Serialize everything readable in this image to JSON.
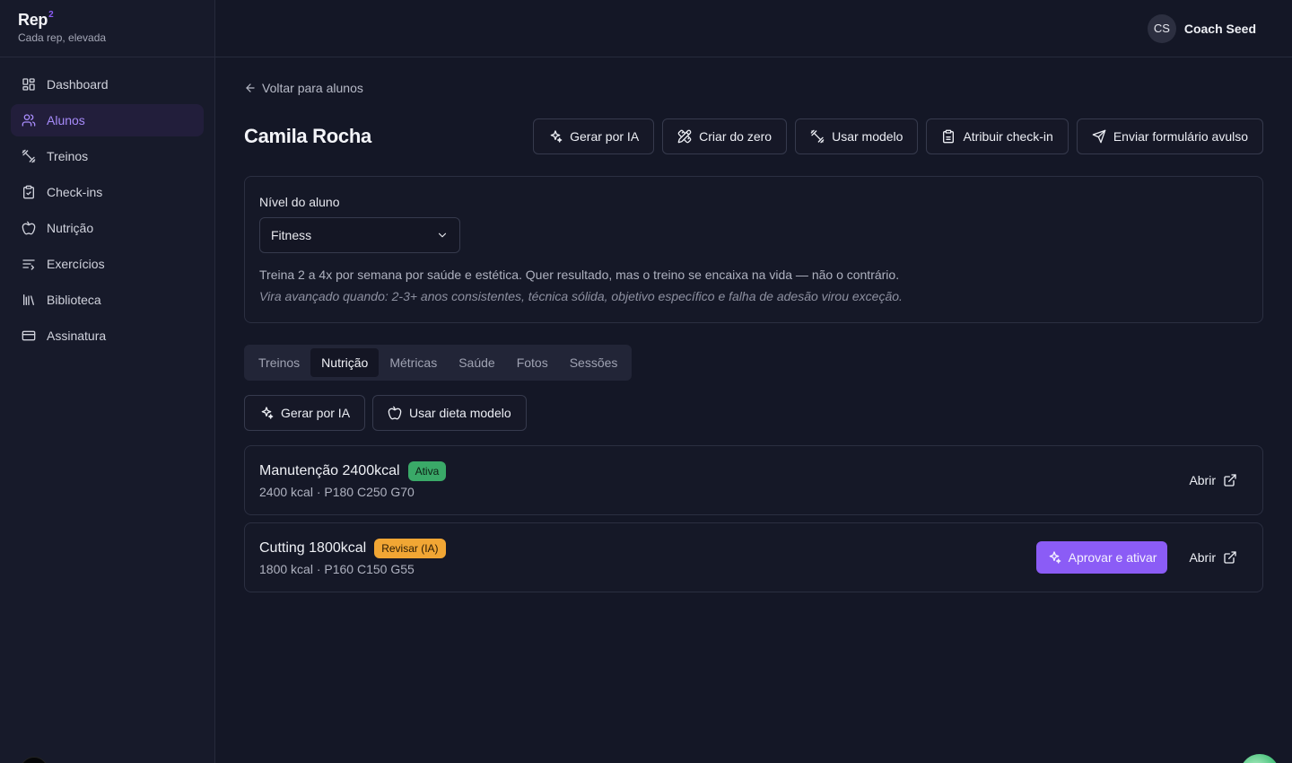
{
  "brand": {
    "name": "Rep",
    "superscript": "2",
    "tagline": "Cada rep, elevada"
  },
  "sidebar": {
    "items": [
      {
        "label": "Dashboard",
        "icon": "dashboard-icon",
        "active": false
      },
      {
        "label": "Alunos",
        "icon": "users-icon",
        "active": true
      },
      {
        "label": "Treinos",
        "icon": "dumbbell-icon",
        "active": false
      },
      {
        "label": "Check-ins",
        "icon": "clipboard-check-icon",
        "active": false
      },
      {
        "label": "Nutrição",
        "icon": "apple-icon",
        "active": false
      },
      {
        "label": "Exercícios",
        "icon": "list-icon",
        "active": false
      },
      {
        "label": "Biblioteca",
        "icon": "library-icon",
        "active": false
      },
      {
        "label": "Assinatura",
        "icon": "credit-card-icon",
        "active": false
      }
    ]
  },
  "user": {
    "initials": "CS",
    "name": "Coach Seed"
  },
  "back_link": "Voltar para alunos",
  "page_title": "Camila Rocha",
  "header_actions": {
    "generate_ai": "Gerar por IA",
    "create_scratch": "Criar do zero",
    "use_template": "Usar modelo",
    "assign_checkin": "Atribuir check-in",
    "send_form": "Enviar formulário avulso"
  },
  "level": {
    "label": "Nível do aluno",
    "selected": "Fitness",
    "description": "Treina 2 a 4x por semana por saúde e estética. Quer resultado, mas o treino se encaixa na vida — não o contrário.",
    "hint": "Vira avançado quando: 2-3+ anos consistentes, técnica sólida, objetivo específico e falha de adesão virou exceção."
  },
  "tabs": [
    "Treinos",
    "Nutrição",
    "Métricas",
    "Saúde",
    "Fotos",
    "Sessões"
  ],
  "active_tab": "Nutrição",
  "nutrition_actions": {
    "generate_ai": "Gerar por IA",
    "use_template": "Usar dieta modelo"
  },
  "diets": [
    {
      "name": "Manutenção 2400kcal",
      "badge": "Ativa",
      "badge_color": "#3aa968",
      "macros": "2400 kcal · P180 C250 G70",
      "open": "Abrir"
    },
    {
      "name": "Cutting 1800kcal",
      "badge": "Revisar (IA)",
      "badge_color": "#f1a634",
      "macros": "1800 kcal · P160 C150 G55",
      "approve": "Aprovar e ativar",
      "open": "Abrir"
    }
  ],
  "colors": {
    "accent": "#8b5cf6",
    "background": "#141726",
    "sidebar_active": "#221e3b"
  }
}
